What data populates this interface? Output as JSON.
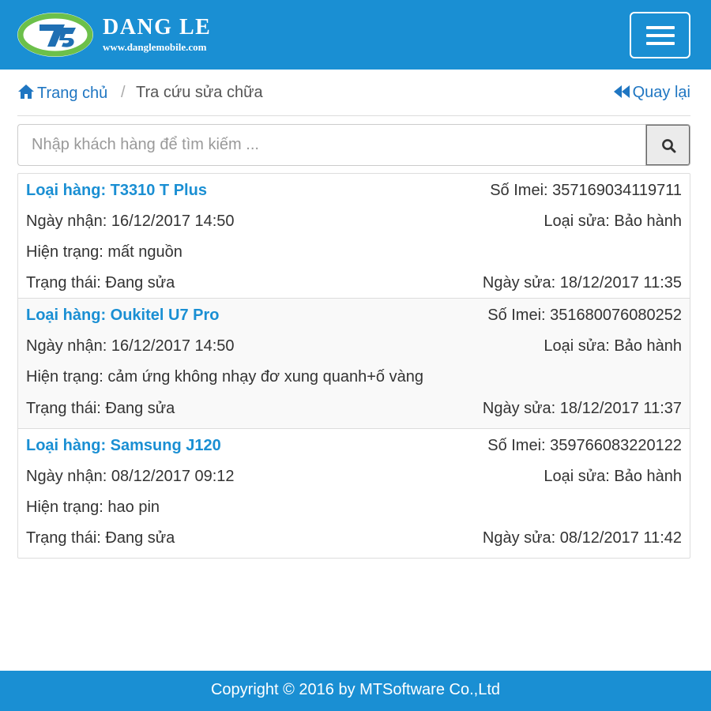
{
  "brand": {
    "name": "DANG LE",
    "website": "www.danglemobile.com",
    "logo_mark": "logo-emblem-icon",
    "color_primary": "#1a8fd3",
    "color_logo_green": "#6cc04a"
  },
  "header": {
    "menu_icon": "hamburger-menu-icon"
  },
  "breadcrumb": {
    "home_label": "Trang chủ",
    "separator": "/",
    "current_label": "Tra cứu sửa chữa",
    "back_label": "Quay lại",
    "home_icon": "home-icon",
    "back_icon": "fast-backward-icon"
  },
  "search": {
    "value": "",
    "placeholder": "Nhập khách hàng để tìm kiếm ...",
    "button_icon": "search-icon"
  },
  "records": [
    {
      "loai_hang": "Loại hàng: T3310 T Plus",
      "so_imei": "Số Imei: 357169034119711",
      "ngay_nhan": "Ngày nhận: 16/12/2017 14:50",
      "loai_sua": "Loại sửa: Bảo hành",
      "hien_trang": "Hiện trạng: mất nguồn",
      "trang_thai": "Trạng thái: Đang sửa",
      "ngay_sua": "Ngày sửa: 18/12/2017 11:35"
    },
    {
      "loai_hang": "Loại hàng: Oukitel U7 Pro",
      "so_imei": "Số Imei: 351680076080252",
      "ngay_nhan": "Ngày nhận: 16/12/2017 14:50",
      "loai_sua": "Loại sửa: Bảo hành",
      "hien_trang": "Hiện trạng: cảm ứng không nhạy đơ xung quanh+ố vàng",
      "trang_thai": "Trạng thái: Đang sửa",
      "ngay_sua": "Ngày sửa: 18/12/2017 11:37"
    },
    {
      "loai_hang": "Loại hàng: Samsung J120",
      "so_imei": "Số Imei: 359766083220122",
      "ngay_nhan": "Ngày nhận: 08/12/2017 09:12",
      "loai_sua": "Loại sửa: Bảo hành",
      "hien_trang": "Hiện trạng: hao pin",
      "trang_thai": "Trạng thái: Đang sửa",
      "ngay_sua": "Ngày sửa: 08/12/2017 11:42"
    }
  ],
  "footer": {
    "copyright": "Copyright © 2016 by MTSoftware Co.,Ltd"
  }
}
